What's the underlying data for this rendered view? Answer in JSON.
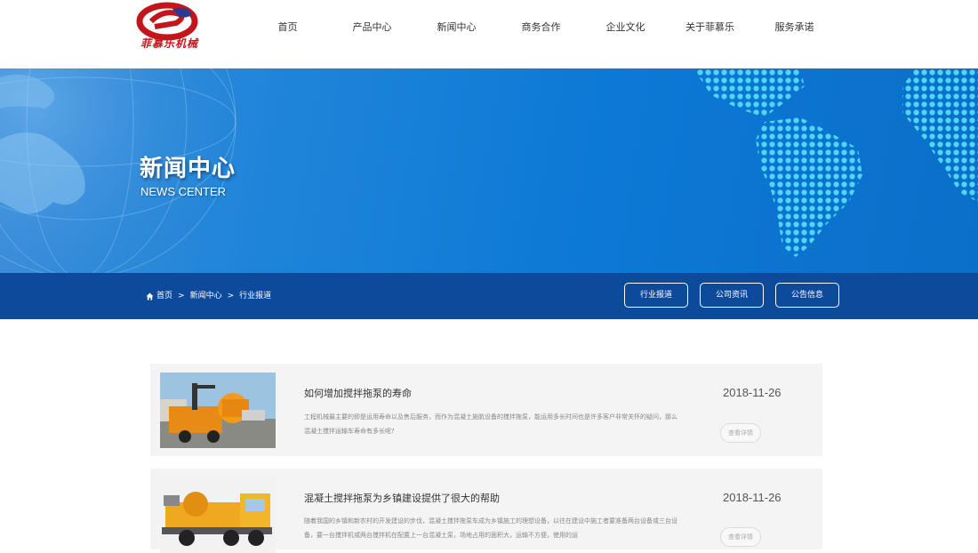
{
  "header": {
    "logo_text": "菲慕乐机械",
    "nav": [
      "首页",
      "产品中心",
      "新闻中心",
      "商务合作",
      "企业文化",
      "关于菲慕乐",
      "服务承诺"
    ]
  },
  "banner": {
    "title": "新闻中心",
    "subtitle": "NEWS CENTER"
  },
  "breadcrumb": {
    "items": [
      "首页",
      "新闻中心",
      "行业报道"
    ],
    "separator": ">"
  },
  "categories": [
    "行业报道",
    "公司资讯",
    "公告信息"
  ],
  "news": [
    {
      "title": "如何增加搅拌拖泵的寿命",
      "desc": "工程机械最主要的即是运用寿命以及售后服务，而作为混凝土施肮设备的搅拌拖泵，能运用多长时间也是许多客户非常关怀的疑问，那么混凝土搅拌运输车寿命有多长呢?",
      "date": "2018-11-26",
      "more": "查看详情"
    },
    {
      "title": "混凝土搅拌拖泵为乡镇建设提供了很大的帮助",
      "desc": "随着我国的乡镇和新农村的开发建设的步伐，混凝土搅拌拖泵车成为乡镇施工的理想设备，以往在建设中施工者要准备两台设备或三台设备，要一台搅拌机或两台搅拌机在配置上一台混凝土泵，场地占用的面积大，运输不方便，使用的运",
      "date": "2018-11-26",
      "more": "查看详情"
    }
  ],
  "colors": {
    "brand_red": "#c3161c",
    "banner_blue": "#1d84d9",
    "subbar_blue": "#0d4a9c"
  }
}
